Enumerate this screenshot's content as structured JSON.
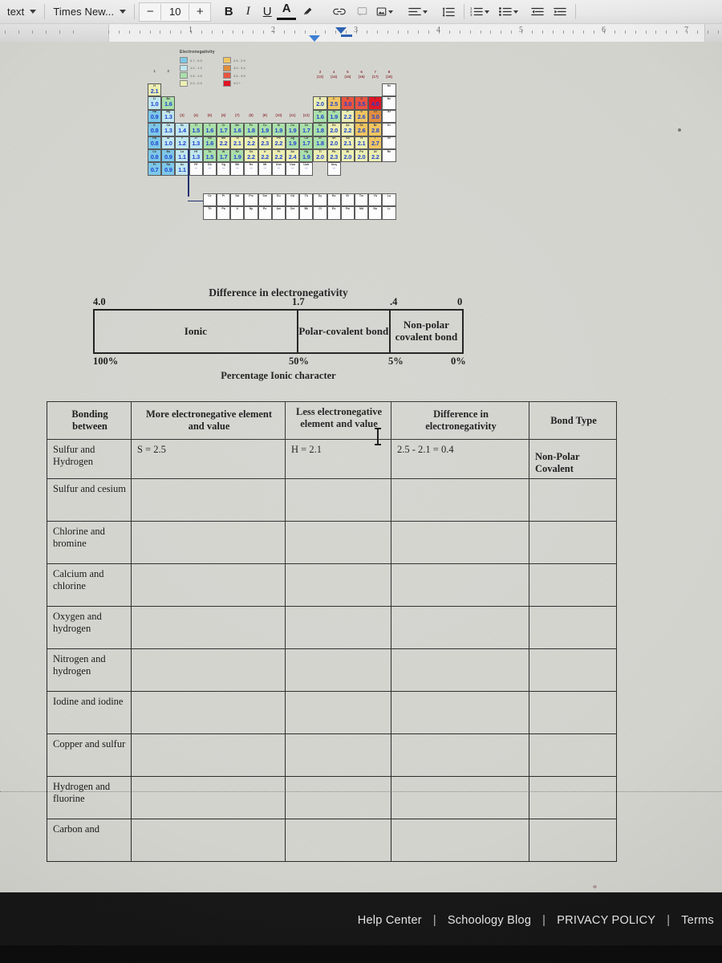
{
  "toolbar": {
    "style_label": "text",
    "font_label": "Times New...",
    "font_decrease": "−",
    "font_size": "10",
    "font_increase": "+",
    "bold": "B",
    "italic": "I",
    "underline": "U",
    "text_color": "A",
    "icons": [
      "highlight-icon",
      "link-icon",
      "comment-icon",
      "image-icon",
      "align-icon",
      "line-spacing-icon",
      "numbered-list-icon",
      "bulleted-list-icon",
      "decrease-indent-icon",
      "increase-indent-icon"
    ]
  },
  "ruler": {
    "numbers": [
      "1",
      "2",
      "3",
      "4",
      "5",
      "6",
      "7"
    ]
  },
  "periodic_table": {
    "legend_title": "Electronegativity",
    "legend": [
      {
        "color": "#79c6e8",
        "range": "0.7 - 0.9"
      },
      {
        "color": "#bfe6ef",
        "range": "1.0 - 1.4"
      },
      {
        "color": "#a8dfa8",
        "range": "1.5 - 1.9"
      },
      {
        "color": "#ecefb0",
        "range": "2.0 - 2.4"
      },
      {
        "color": "#f0c35c",
        "range": "2.5 - 2.9"
      },
      {
        "color": "#e08b3a",
        "range": "3.0 - 3.4"
      },
      {
        "color": "#e8503c",
        "range": "3.5 - 3.9"
      },
      {
        "color": "#e01020",
        "range": "4.0 +"
      }
    ],
    "group_labels_left": [
      "1",
      "2"
    ],
    "group_labels_right": [
      {
        "top": "3",
        "bot": "(13)"
      },
      {
        "top": "4",
        "bot": "(14)"
      },
      {
        "top": "5",
        "bot": "(15)"
      },
      {
        "top": "6",
        "bot": "(16)"
      },
      {
        "top": "7",
        "bot": "(17)"
      },
      {
        "top": "8",
        "bot": "(18)"
      }
    ],
    "group_labels_mid": [
      "(3)",
      "(4)",
      "(5)",
      "(6)",
      "(7)",
      "(8)",
      "(9)",
      "(10)",
      "(11)",
      "(12)"
    ],
    "rows": [
      [
        {
          "s": "H",
          "v": "2.1",
          "c": "#ecefb0"
        }
      ],
      [
        {
          "s": "Li",
          "v": "1.0",
          "c": "#bfe6ef"
        },
        {
          "s": "Be",
          "v": "1.6",
          "c": "#a8dfa8"
        }
      ],
      [
        {
          "s": "Na",
          "v": "0.9",
          "c": "#79c6e8"
        },
        {
          "s": "Mg",
          "v": "1.3",
          "c": "#bfe6ef"
        }
      ],
      [
        {
          "s": "K",
          "v": "0.8",
          "c": "#79c6e8"
        },
        {
          "s": "Ca",
          "v": "1.3",
          "c": "#bfe6ef"
        },
        {
          "s": "Sc",
          "v": "1.4",
          "c": "#bfe6ef"
        },
        {
          "s": "Ti",
          "v": "1.5",
          "c": "#a8dfa8"
        },
        {
          "s": "V",
          "v": "1.6",
          "c": "#a8dfa8"
        },
        {
          "s": "Cr",
          "v": "1.7",
          "c": "#a8dfa8"
        },
        {
          "s": "Mn",
          "v": "1.6",
          "c": "#a8dfa8"
        },
        {
          "s": "Fe",
          "v": "1.8",
          "c": "#a8dfa8"
        },
        {
          "s": "Co",
          "v": "1.9",
          "c": "#a8dfa8"
        },
        {
          "s": "Ni",
          "v": "1.9",
          "c": "#a8dfa8"
        },
        {
          "s": "Cu",
          "v": "1.9",
          "c": "#a8dfa8"
        },
        {
          "s": "Zn",
          "v": "1.7",
          "c": "#a8dfa8"
        },
        {
          "s": "Ga",
          "v": "1.8",
          "c": "#a8dfa8"
        },
        {
          "s": "Ge",
          "v": "2.0",
          "c": "#ecefb0"
        },
        {
          "s": "As",
          "v": "2.2",
          "c": "#ecefb0"
        },
        {
          "s": "Se",
          "v": "2.6",
          "c": "#f0c35c"
        },
        {
          "s": "Br",
          "v": "2.8",
          "c": "#f0c35c"
        }
      ],
      [
        {
          "s": "Rb",
          "v": "0.8",
          "c": "#79c6e8"
        },
        {
          "s": "Sr",
          "v": "1.0",
          "c": "#bfe6ef"
        },
        {
          "s": "Y",
          "v": "1.2",
          "c": "#bfe6ef"
        },
        {
          "s": "Zr",
          "v": "1.3",
          "c": "#bfe6ef"
        },
        {
          "s": "Nb",
          "v": "1.6",
          "c": "#a8dfa8"
        },
        {
          "s": "Mo",
          "v": "2.2",
          "c": "#ecefb0"
        },
        {
          "s": "Tc",
          "v": "2.1",
          "c": "#ecefb0"
        },
        {
          "s": "Ru",
          "v": "2.2",
          "c": "#ecefb0"
        },
        {
          "s": "Rh",
          "v": "2.3",
          "c": "#ecefb0"
        },
        {
          "s": "Pd",
          "v": "2.2",
          "c": "#ecefb0"
        },
        {
          "s": "Ag",
          "v": "1.9",
          "c": "#a8dfa8"
        },
        {
          "s": "Cd",
          "v": "1.7",
          "c": "#a8dfa8"
        },
        {
          "s": "In",
          "v": "1.8",
          "c": "#a8dfa8"
        },
        {
          "s": "Sn",
          "v": "2.0",
          "c": "#ecefb0"
        },
        {
          "s": "Sb",
          "v": "2.1",
          "c": "#ecefb0"
        },
        {
          "s": "Te",
          "v": "2.1",
          "c": "#ecefb0"
        },
        {
          "s": "I",
          "v": "2.7",
          "c": "#f0c35c"
        }
      ],
      [
        {
          "s": "Cs",
          "v": "0.8",
          "c": "#79c6e8"
        },
        {
          "s": "Ba",
          "v": "0.9",
          "c": "#79c6e8"
        },
        {
          "s": "La",
          "v": "1.1",
          "c": "#bfe6ef"
        },
        {
          "s": "Hf",
          "v": "1.3",
          "c": "#bfe6ef"
        },
        {
          "s": "Ta",
          "v": "1.5",
          "c": "#a8dfa8"
        },
        {
          "s": "W",
          "v": "1.7",
          "c": "#a8dfa8"
        },
        {
          "s": "Re",
          "v": "1.9",
          "c": "#a8dfa8"
        },
        {
          "s": "Os",
          "v": "2.2",
          "c": "#ecefb0"
        },
        {
          "s": "Ir",
          "v": "2.2",
          "c": "#ecefb0"
        },
        {
          "s": "Pt",
          "v": "2.2",
          "c": "#ecefb0"
        },
        {
          "s": "Au",
          "v": "2.4",
          "c": "#ecefb0"
        },
        {
          "s": "Hg",
          "v": "1.9",
          "c": "#a8dfa8"
        },
        {
          "s": "Tl",
          "v": "2.0",
          "c": "#ecefb0"
        },
        {
          "s": "Pb",
          "v": "2.3",
          "c": "#ecefb0"
        },
        {
          "s": "Bi",
          "v": "2.0",
          "c": "#ecefb0"
        },
        {
          "s": "Po",
          "v": "2.0",
          "c": "#ecefb0"
        },
        {
          "s": "At",
          "v": "2.2",
          "c": "#ecefb0"
        }
      ],
      [
        {
          "s": "Fr",
          "v": "0.7",
          "c": "#79c6e8"
        },
        {
          "s": "Ra",
          "v": "0.9",
          "c": "#79c6e8"
        },
        {
          "s": "Ac",
          "v": "1.1",
          "c": "#bfe6ef"
        }
      ]
    ],
    "p_block": [
      [
        {
          "s": "B",
          "v": "2.0",
          "c": "#ecefb0"
        },
        {
          "s": "C",
          "v": "2.5",
          "c": "#f0c35c"
        },
        {
          "s": "N",
          "v": "3.0",
          "c": "#e8503c"
        },
        {
          "s": "O",
          "v": "3.5",
          "c": "#e8503c"
        },
        {
          "s": "F",
          "v": "4.0",
          "c": "#e01020"
        }
      ],
      [
        {
          "s": "Al",
          "v": "1.6",
          "c": "#a8dfa8"
        },
        {
          "s": "Si",
          "v": "1.9",
          "c": "#a8dfa8"
        },
        {
          "s": "P",
          "v": "2.2",
          "c": "#ecefb0"
        },
        {
          "s": "S",
          "v": "2.6",
          "c": "#f0c35c"
        },
        {
          "s": "Cl",
          "v": "3.0",
          "c": "#e08b3a"
        }
      ]
    ],
    "noble": [
      "He",
      "Ne",
      "Ar",
      "Kr",
      "Xe",
      "Rn"
    ],
    "row7": [
      "Rf",
      "Db",
      "Sg",
      "Bh",
      "Hs",
      "Mt",
      "Uun",
      "Uuu",
      "Uub",
      "",
      "Uuq"
    ],
    "lanthanides": [
      "Ce",
      "Pr",
      "Nd",
      "Pm",
      "Sm",
      "Eu",
      "Gd",
      "Tb",
      "Dy",
      "Ho",
      "Er",
      "Tm",
      "Yb",
      "Lu"
    ],
    "actinides": [
      "Th",
      "Pa",
      "U",
      "Np",
      "Pu",
      "Am",
      "Cm",
      "Bk",
      "Cf",
      "Es",
      "Fm",
      "Md",
      "No",
      "Lr"
    ]
  },
  "diagram": {
    "title": "Difference in electronegativity",
    "top_labels": [
      "4.0",
      "1.7",
      ".4",
      "0"
    ],
    "cells": [
      "Ionic",
      "Polar-covalent bond",
      "Non-polar covalent bond"
    ],
    "bottom_labels": [
      "100%",
      "50%",
      "5%",
      "0%"
    ],
    "footer": "Percentage Ionic character"
  },
  "worksheet": {
    "headers": [
      "Bonding between",
      "More electronegative element and value",
      "Less electronegative element and value",
      "Difference in electronegativity",
      "Bond Type"
    ],
    "rows": [
      {
        "bonding": "Sulfur and Hydrogen",
        "more": "S = 2.5",
        "less": "H = 2.1",
        "diff": "2.5 - 2.1 = 0.4",
        "type": "Non-Polar Covalent"
      },
      {
        "bonding": "Sulfur and cesium",
        "more": "",
        "less": "",
        "diff": "",
        "type": ""
      },
      {
        "bonding": "Chlorine and bromine",
        "more": "",
        "less": "",
        "diff": "",
        "type": ""
      },
      {
        "bonding": "Calcium and chlorine",
        "more": "",
        "less": "",
        "diff": "",
        "type": ""
      },
      {
        "bonding": "Oxygen and hydrogen",
        "more": "",
        "less": "",
        "diff": "",
        "type": ""
      },
      {
        "bonding": "Nitrogen and hydrogen",
        "more": "",
        "less": "",
        "diff": "",
        "type": ""
      },
      {
        "bonding": "Iodine and iodine",
        "more": "",
        "less": "",
        "diff": "",
        "type": ""
      },
      {
        "bonding": "Copper and sulfur",
        "more": "",
        "less": "",
        "diff": "",
        "type": ""
      },
      {
        "bonding": "Hydrogen and fluorine",
        "more": "",
        "less": "",
        "diff": "",
        "type": ""
      },
      {
        "bonding": "Carbon and",
        "more": "",
        "less": "",
        "diff": "",
        "type": ""
      }
    ]
  },
  "footer": {
    "links": [
      "Help Center",
      "Schoology Blog",
      "PRIVACY POLICY",
      "Terms"
    ],
    "separator": "|"
  },
  "colors": {
    "page_background": "#d3d3ce",
    "toolbar_background": "#e8e8e8",
    "footer_background": "#171717",
    "accent_blue": "#2b5fb0",
    "ink": "#161616"
  }
}
